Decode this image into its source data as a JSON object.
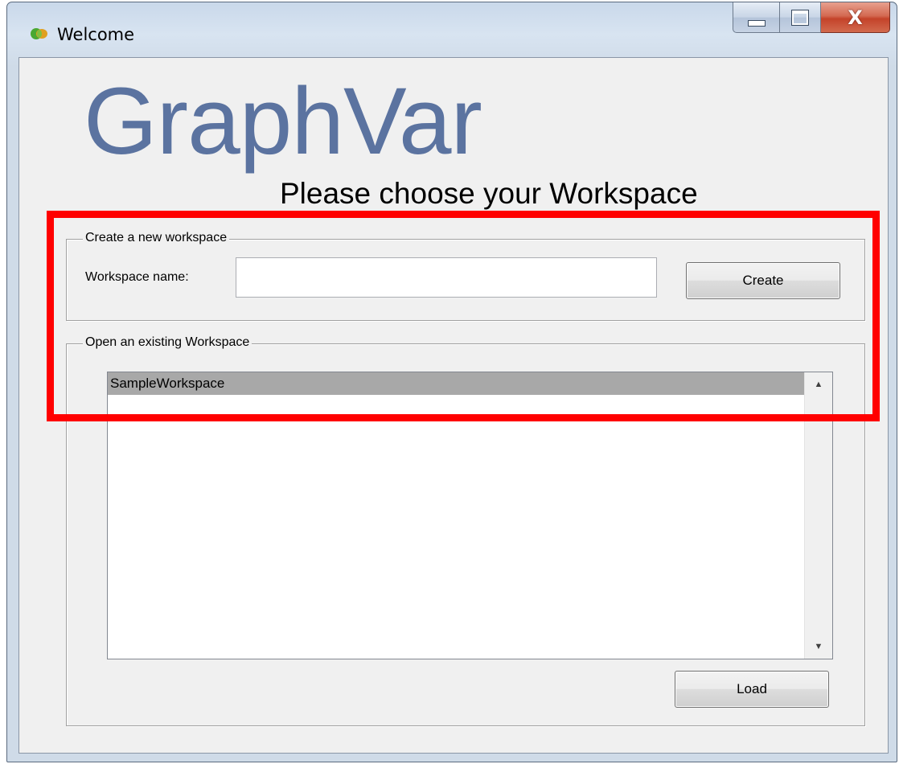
{
  "window": {
    "title": "Welcome",
    "icon": "graphvar-app-icon",
    "controls": {
      "minimize": "minimize-icon",
      "maximize": "maximize-icon",
      "close_label": "X"
    }
  },
  "header": {
    "app_name": "GraphVar",
    "subtitle": "Please choose your Workspace"
  },
  "create_section": {
    "legend": "Create a new workspace",
    "name_label": "Workspace name:",
    "name_value": "",
    "create_button": "Create"
  },
  "open_section": {
    "legend": "Open an existing Workspace",
    "workspaces": [
      "SampleWorkspace"
    ],
    "selected_index": 0,
    "scroll_up": "▲",
    "scroll_down": "▼",
    "load_button": "Load"
  },
  "colors": {
    "app_name": "#5b73a0",
    "highlight": "#ff0000",
    "selection": "#a8a8a8"
  }
}
